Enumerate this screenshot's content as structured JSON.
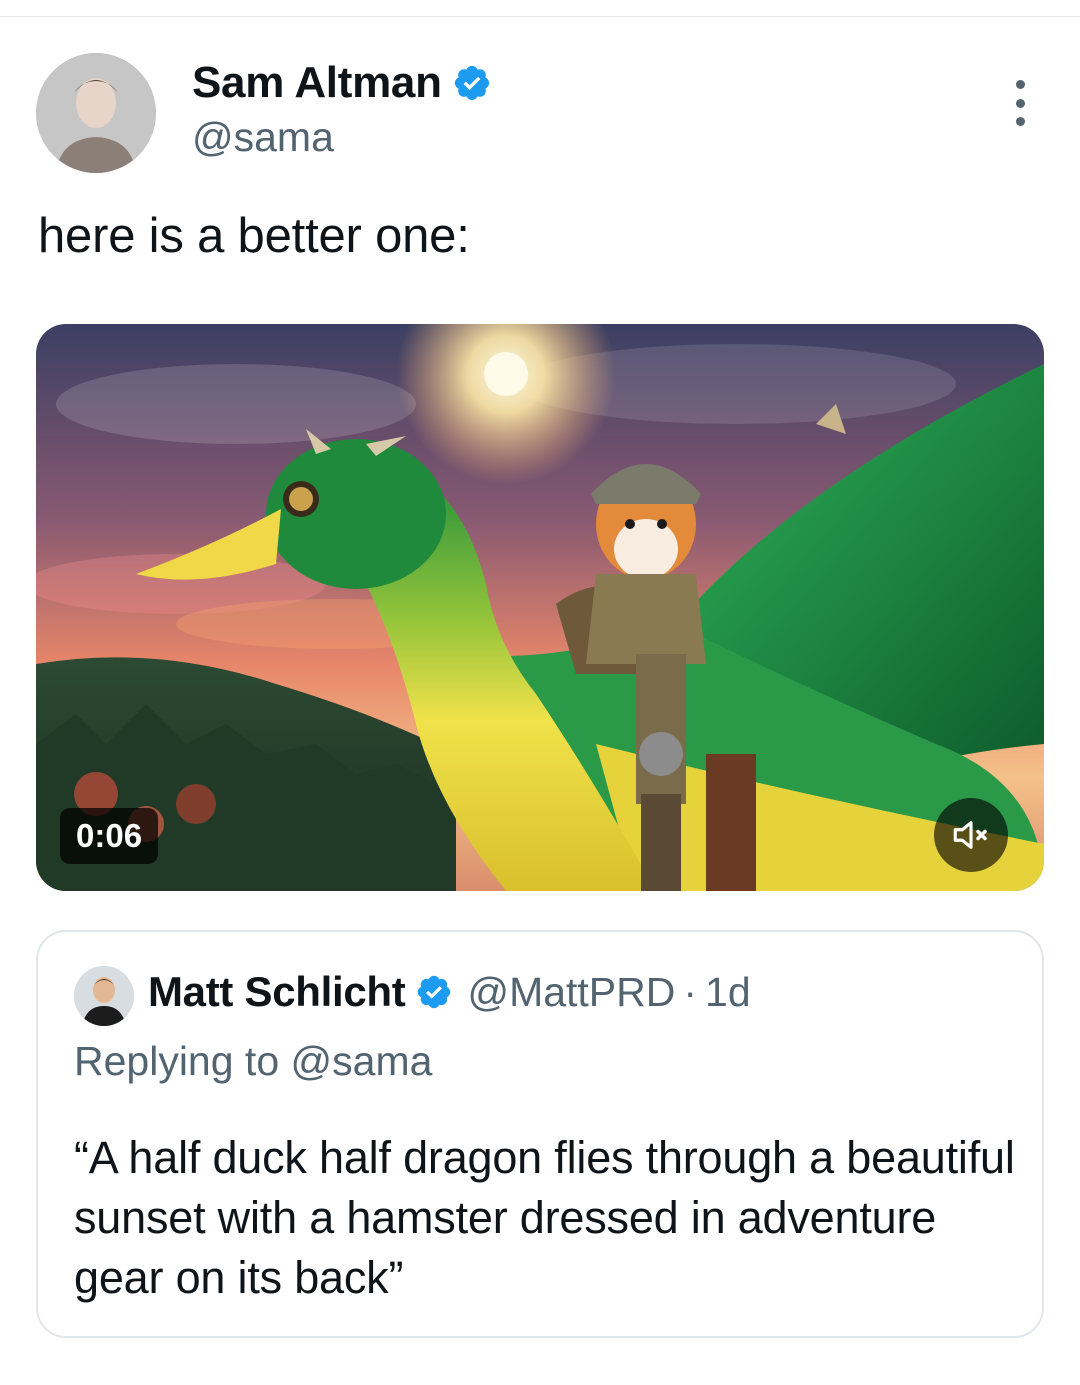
{
  "tweet": {
    "author": {
      "display_name": "Sam Altman",
      "handle": "@sama",
      "verified": true
    },
    "text": "here is a better one:",
    "media": {
      "type": "video",
      "duration": "0:06",
      "muted": true,
      "icon_mute": "speaker-muted-icon"
    },
    "menu_icon": "more-vertical-icon"
  },
  "quoted_tweet": {
    "author": {
      "display_name": "Matt Schlicht",
      "handle": "@MattPRD",
      "verified": true
    },
    "separator": "·",
    "time": "1d",
    "replying_prefix": "Replying to",
    "replying_to": "@sama",
    "text": "“A half duck half dragon flies through a beautiful sunset with a hamster dressed in adventure gear on its back”"
  },
  "colors": {
    "verified_blue": "#1d9bf0",
    "secondary_text": "#536471",
    "primary_text": "#0f1419",
    "border": "#e1e6ea"
  }
}
